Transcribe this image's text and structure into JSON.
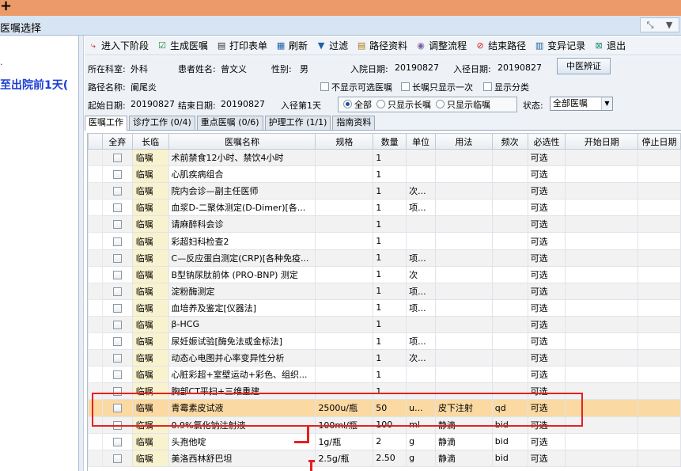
{
  "window": {
    "title": "医嘱选择"
  },
  "left_panel": {
    "item_label": "至出院前1天("
  },
  "toolbar": [
    {
      "label": "进入下阶段",
      "icon": "enter-next-stage-icon"
    },
    {
      "label": "生成医嘱",
      "icon": "generate-order-icon"
    },
    {
      "label": "打印表单",
      "icon": "print-icon"
    },
    {
      "label": "刷新",
      "icon": "refresh-icon"
    },
    {
      "label": "过滤",
      "icon": "filter-icon"
    },
    {
      "label": "路径资料",
      "icon": "path-info-icon"
    },
    {
      "label": "调整流程",
      "icon": "adjust-flow-icon"
    },
    {
      "label": "结束路径",
      "icon": "end-path-icon"
    },
    {
      "label": "变异记录",
      "icon": "variation-record-icon"
    },
    {
      "label": "退出",
      "icon": "exit-icon"
    }
  ],
  "info": {
    "dept_label": "所在科室:",
    "dept": "外科",
    "patient_label": "患者姓名:",
    "patient": "曾文义",
    "gender_label": "性别:",
    "gender": "男",
    "admit_label": "入院日期:",
    "admit": "20190827",
    "path_enter_label": "入径日期:",
    "path_enter": "20190827",
    "tcm_button": "中医辨证",
    "path_name_label": "路径名称:",
    "path_name": "阑尾炎",
    "cb_hide_optional": "不显示可选医嘱",
    "cb_long_once": "长嘱只显示一次",
    "cb_show_category": "显示分类",
    "start_label": "起始日期:",
    "start": "20190827",
    "end_label": "结束日期:",
    "end": "20190827",
    "day_label": "入径第1天",
    "radio_all": "全部",
    "radio_long": "只显示长嘱",
    "radio_temp": "只显示临嘱",
    "status_label": "状态:",
    "status_value": "全部医嘱"
  },
  "tabs": [
    {
      "label": "医嘱工作",
      "active": true
    },
    {
      "label": "诊疗工作 (0/4)",
      "active": false
    },
    {
      "label": "重点医嘱 (0/6)",
      "active": false
    },
    {
      "label": "护理工作 (1/1)",
      "active": false
    },
    {
      "label": "指南资料",
      "active": false
    }
  ],
  "table": {
    "headers": [
      "",
      "全弃",
      "长临",
      "医嘱名称",
      "规格",
      "数量",
      "单位",
      "用法",
      "频次",
      "必选性",
      "开始日期",
      "停止日期"
    ],
    "rows": [
      [
        "临嘱",
        "术前禁食12小时、禁饮4小时",
        "",
        "1",
        "",
        "",
        "",
        "可选"
      ],
      [
        "临嘱",
        "心肌疾病组合",
        "",
        "1",
        "",
        "",
        "",
        "可选"
      ],
      [
        "临嘱",
        "院内会诊—副主任医师",
        "",
        "1",
        "次...",
        "",
        "",
        "可选"
      ],
      [
        "临嘱",
        "血浆D-二聚体测定(D-Dimer)[各...",
        "",
        "1",
        "项...",
        "",
        "",
        "可选"
      ],
      [
        "临嘱",
        "请麻醉科会诊",
        "",
        "1",
        "",
        "",
        "",
        "可选"
      ],
      [
        "临嘱",
        "彩超妇科检查2",
        "",
        "1",
        "",
        "",
        "",
        "可选"
      ],
      [
        "临嘱",
        "C—反应蛋白测定(CRP)[各种免疫...",
        "",
        "1",
        "项...",
        "",
        "",
        "可选"
      ],
      [
        "临嘱",
        "B型钠尿肽前体 (PRO-BNP) 测定",
        "",
        "1",
        "次",
        "",
        "",
        "可选"
      ],
      [
        "临嘱",
        "淀粉酶测定",
        "",
        "1",
        "项...",
        "",
        "",
        "可选"
      ],
      [
        "临嘱",
        "血培养及鉴定[仪器法]",
        "",
        "1",
        "项...",
        "",
        "",
        "可选"
      ],
      [
        "临嘱",
        "β-HCG",
        "",
        "1",
        "",
        "",
        "",
        "可选"
      ],
      [
        "临嘱",
        "尿妊娠试验[酶免法或金标法]",
        "",
        "1",
        "项...",
        "",
        "",
        "可选"
      ],
      [
        "临嘱",
        "动态心电图并心率变异性分析",
        "",
        "1",
        "次...",
        "",
        "",
        "可选"
      ],
      [
        "临嘱",
        "心脏彩超+室壁运动+彩色、组织...",
        "",
        "1",
        "",
        "",
        "",
        "可选"
      ],
      [
        "临嘱",
        "胸部CT平扫+三维重建",
        "",
        "1",
        "",
        "",
        "",
        "可选"
      ],
      [
        "临嘱",
        "青霉素皮试液",
        "2500u/瓶",
        "50",
        "u...",
        "皮下注射",
        "qd",
        "可选"
      ],
      [
        "临嘱",
        "0.9%氯化钠注射液",
        "100ml/瓶",
        "100",
        "ml",
        "静滴",
        "bid",
        "可选"
      ],
      [
        "临嘱",
        "头孢他啶",
        "1g/瓶",
        "2",
        "g",
        "静滴",
        "bid",
        "可选"
      ],
      [
        "临嘱",
        "美洛西林舒巴坦",
        "2.5g/瓶",
        "2.50",
        "g",
        "静滴",
        "bid",
        "可选"
      ]
    ],
    "highlight_row": 15
  }
}
